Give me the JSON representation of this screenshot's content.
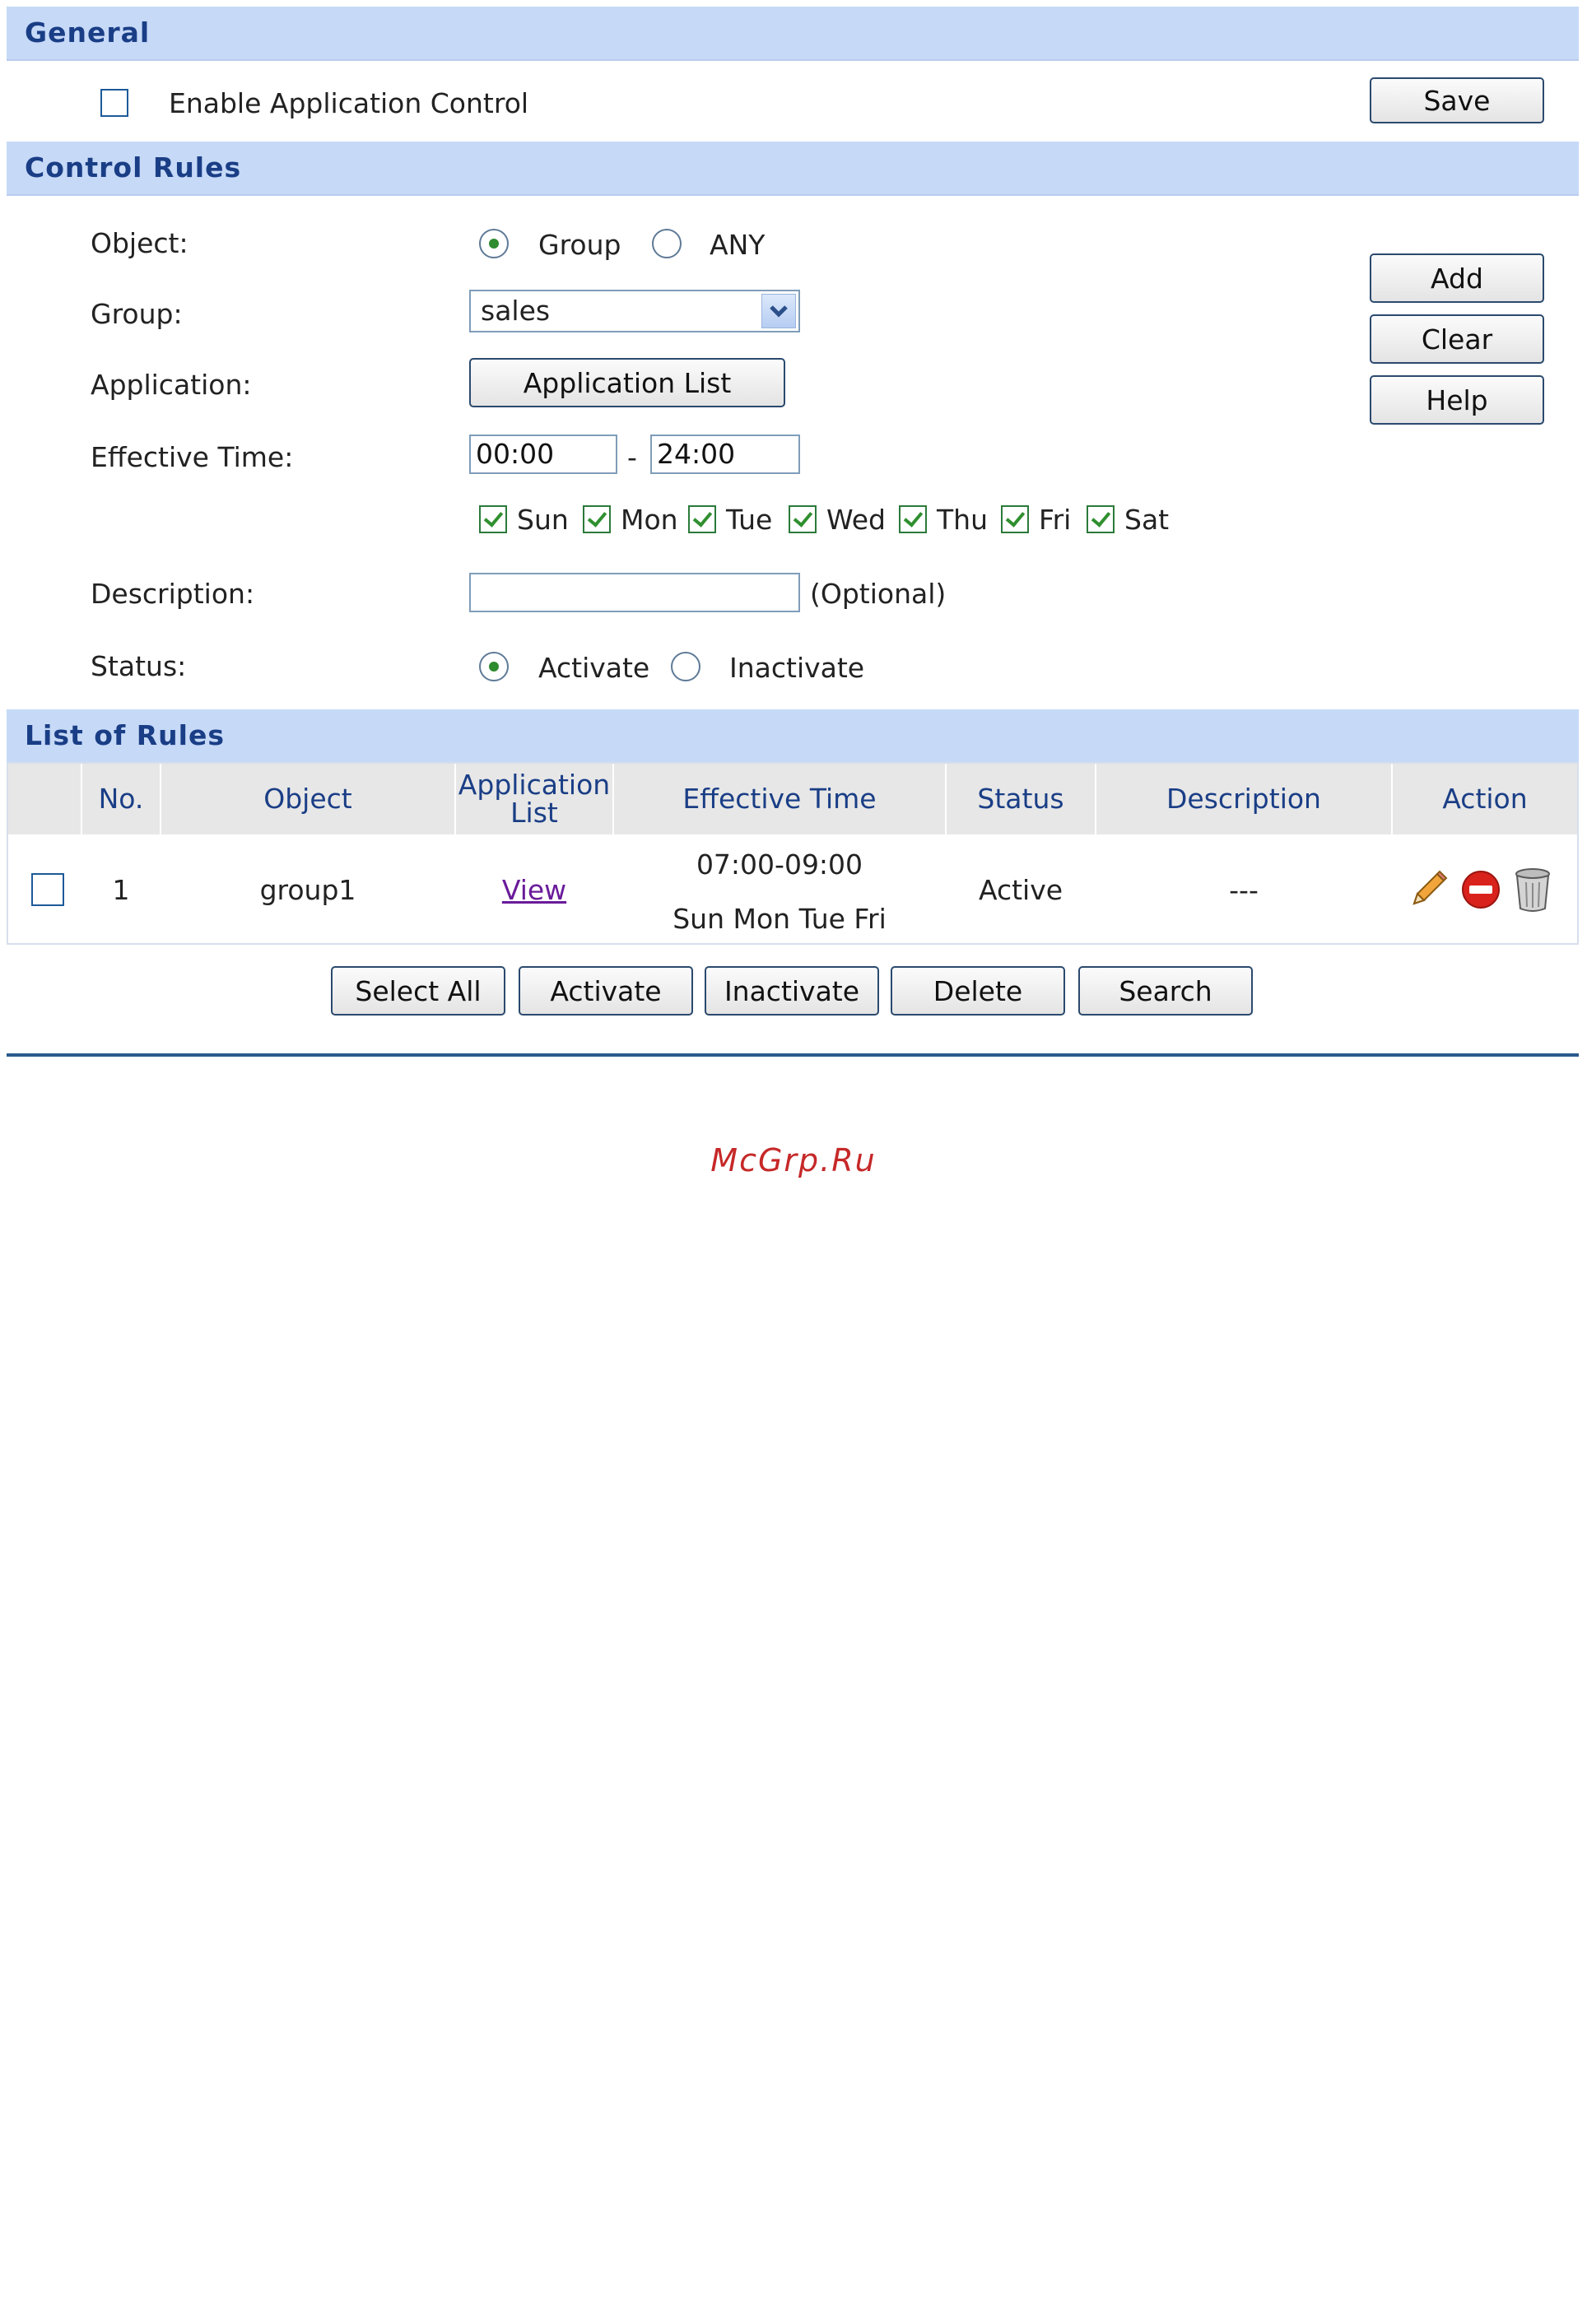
{
  "general": {
    "title": "General",
    "enable_label": "Enable Application Control",
    "enable_checked": false,
    "save_label": "Save"
  },
  "control_rules": {
    "title": "Control Rules",
    "object_label": "Object:",
    "object_options": [
      "Group",
      "ANY"
    ],
    "object_selected": "Group",
    "group_label": "Group:",
    "group_value": "sales",
    "application_label": "Application:",
    "application_button": "Application List",
    "time_label": "Effective Time:",
    "time_start": "00:00",
    "time_separator": "-",
    "time_end": "24:00",
    "days": [
      {
        "label": "Sun",
        "checked": true
      },
      {
        "label": "Mon",
        "checked": true
      },
      {
        "label": "Tue",
        "checked": true
      },
      {
        "label": "Wed",
        "checked": true
      },
      {
        "label": "Thu",
        "checked": true
      },
      {
        "label": "Fri",
        "checked": true
      },
      {
        "label": "Sat",
        "checked": true
      }
    ],
    "description_label": "Description:",
    "description_value": "",
    "optional_label": "(Optional)",
    "status_label": "Status:",
    "status_options": [
      "Activate",
      "Inactivate"
    ],
    "status_selected": "Activate",
    "add_label": "Add",
    "clear_label": "Clear",
    "help_label": "Help"
  },
  "rules_list": {
    "title": "List of Rules",
    "columns": [
      "No.",
      "Object",
      "Application List",
      "Effective Time",
      "Status",
      "Description",
      "Action"
    ],
    "rows": [
      {
        "no": "1",
        "object": "group1",
        "application": "View",
        "time": "07:00-09:00",
        "days": "Sun Mon Tue Fri",
        "status": "Active",
        "description": "---",
        "actions": [
          "edit-icon",
          "disable-icon",
          "delete-icon"
        ]
      }
    ],
    "buttons": [
      "Select All",
      "Activate",
      "Inactivate",
      "Delete",
      "Search"
    ]
  },
  "watermark": "McGrp.Ru",
  "colors": {
    "section_bar": "#c6d9f7",
    "section_title": "#1a3e86",
    "link": "#6a1b9a",
    "watermark": "#c62828",
    "divider": "#2a5a8c"
  }
}
